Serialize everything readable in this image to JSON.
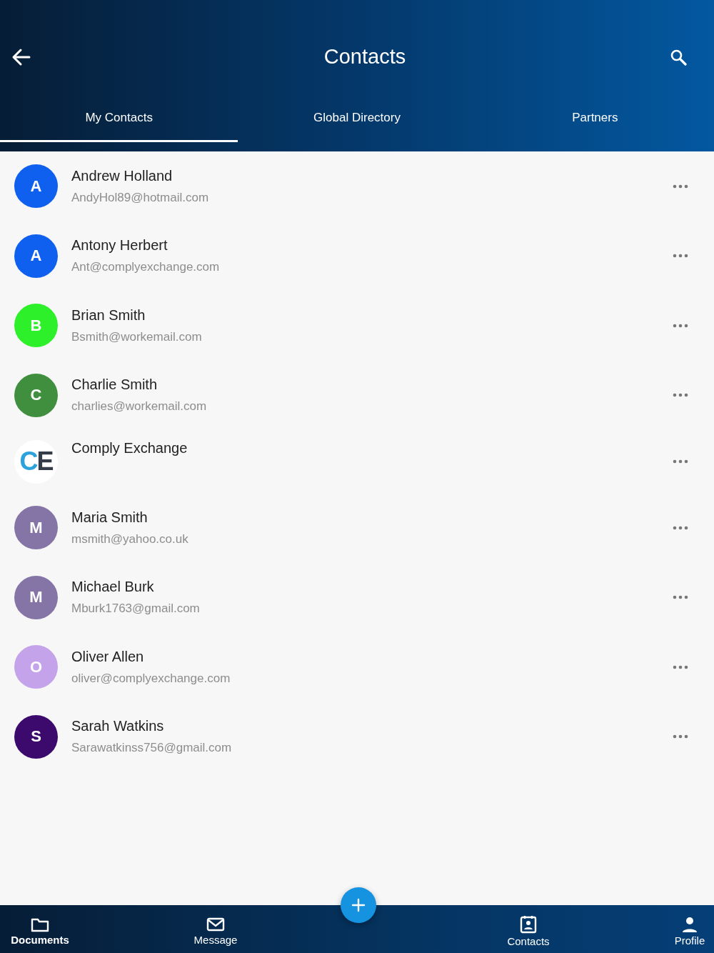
{
  "header": {
    "title": "Contacts"
  },
  "tabs": [
    {
      "label": "My Contacts",
      "selected": true
    },
    {
      "label": "Global Directory",
      "selected": false
    },
    {
      "label": "Partners",
      "selected": false
    }
  ],
  "contacts": [
    {
      "kind": "initial",
      "initial": "A",
      "color": "#1060f0",
      "name": "Andrew Holland",
      "email": "AndyHol89@hotmail.com"
    },
    {
      "kind": "initial",
      "initial": "A",
      "color": "#1060f0",
      "name": "Antony Herbert",
      "email": "Ant@complyexchange.com"
    },
    {
      "kind": "initial",
      "initial": "B",
      "color": "#2ef02a",
      "name": "Brian Smith",
      "email": "Bsmith@workemail.com"
    },
    {
      "kind": "initial",
      "initial": "C",
      "color": "#3f8f3f",
      "name": "Charlie Smith",
      "email": "charlies@workemail.com"
    },
    {
      "kind": "logo",
      "initial": "CE",
      "name": "Comply Exchange"
    },
    {
      "kind": "initial",
      "initial": "M",
      "color": "#8574a6",
      "name": "Maria Smith",
      "email": "msmith@yahoo.co.uk"
    },
    {
      "kind": "initial",
      "initial": "M",
      "color": "#8574a6",
      "name": "Michael Burk",
      "email": "Mburk1763@gmail.com"
    },
    {
      "kind": "initial",
      "initial": "O",
      "color": "#c4a3ea",
      "name": "Oliver Allen",
      "email": "oliver@complyexchange.com"
    },
    {
      "kind": "initial",
      "initial": "S",
      "color": "#3c0a6c",
      "name": "Sarah Watkins",
      "email": "Sarawatkinss756@gmail.com"
    }
  ],
  "nav": [
    {
      "kind": "folder",
      "label": "Documents",
      "selected": true
    },
    {
      "kind": "mail",
      "label": "Message",
      "selected": false
    },
    {
      "kind": "gap"
    },
    {
      "kind": "badge",
      "label": "Contacts",
      "selected": false
    },
    {
      "kind": "person",
      "label": "Profile",
      "selected": false
    }
  ]
}
